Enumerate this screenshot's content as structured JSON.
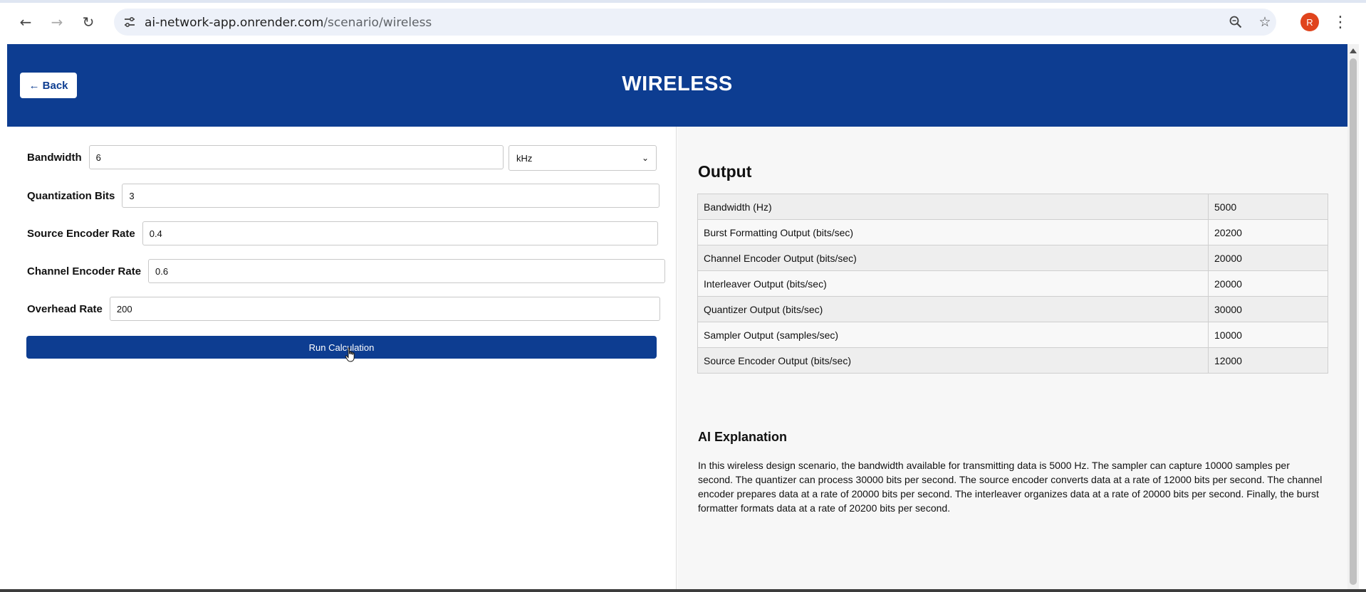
{
  "browser": {
    "url_host": "ai-network-app.onrender.com",
    "url_path": "/scenario/wireless",
    "avatar_letter": "R",
    "icons": {
      "back": "arrow-left-icon",
      "forward": "arrow-right-icon",
      "reload": "reload-icon",
      "site_info": "tune-icon",
      "zoom": "zoom-icon",
      "bookmark": "star-icon",
      "menu": "kebab-menu-icon"
    }
  },
  "header": {
    "back_label": "← Back",
    "title": "WIRELESS",
    "bg_color": "#0d3d91"
  },
  "form": {
    "bandwidth": {
      "label": "Bandwidth",
      "value": "6",
      "unit": "kHz"
    },
    "quant_bits": {
      "label": "Quantization Bits",
      "value": "3"
    },
    "source_rate": {
      "label": "Source Encoder Rate",
      "value": "0.4"
    },
    "channel_rate": {
      "label": "Channel Encoder Rate",
      "value": "0.6"
    },
    "overhead_rate": {
      "label": "Overhead Rate",
      "value": "200"
    },
    "run_label": "Run Calculation"
  },
  "output": {
    "title": "Output",
    "rows": [
      {
        "label": "Bandwidth (Hz)",
        "value": "5000"
      },
      {
        "label": "Burst Formatting Output (bits/sec)",
        "value": "20200"
      },
      {
        "label": "Channel Encoder Output (bits/sec)",
        "value": "20000"
      },
      {
        "label": "Interleaver Output (bits/sec)",
        "value": "20000"
      },
      {
        "label": "Quantizer Output (bits/sec)",
        "value": "30000"
      },
      {
        "label": "Sampler Output (samples/sec)",
        "value": "10000"
      },
      {
        "label": "Source Encoder Output (bits/sec)",
        "value": "12000"
      }
    ]
  },
  "ai": {
    "title": "AI Explanation",
    "text": "In this wireless design scenario, the bandwidth available for transmitting data is 5000 Hz. The sampler can capture 10000 samples per second. The quantizer can process 30000 bits per second. The source encoder converts data at a rate of 12000 bits per second. The channel encoder prepares data at a rate of 20000 bits per second. The interleaver organizes data at a rate of 20000 bits per second. Finally, the burst formatter formats data at a rate of 20200 bits per second."
  }
}
